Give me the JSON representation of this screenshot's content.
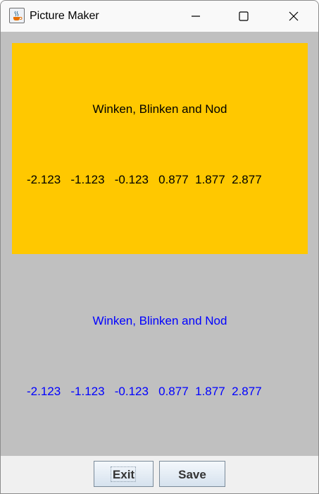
{
  "window": {
    "title": "Picture Maker",
    "controls": [
      "minimize",
      "maximize",
      "close"
    ]
  },
  "canvas": {
    "top_panel": {
      "background": "#ffc800",
      "text_color": "#000000",
      "caption": "Winken, Blinken and Nod",
      "numbers": [
        "-2.123",
        "-1.123",
        "-0.123",
        "0.877",
        "1.877",
        "2.877"
      ]
    },
    "bottom_panel": {
      "background": "#c0c0c0",
      "text_color": "#0000ff",
      "caption": "Winken, Blinken and Nod",
      "numbers": [
        "-2.123",
        "-1.123",
        "-0.123",
        "0.877",
        "1.877",
        "2.877"
      ]
    }
  },
  "buttons": {
    "exit_label": "Exit",
    "save_label": "Save"
  },
  "icons": {
    "app": "java-coffee-cup-icon",
    "minimize": "minimize-icon",
    "maximize": "maximize-icon",
    "close": "close-icon"
  }
}
